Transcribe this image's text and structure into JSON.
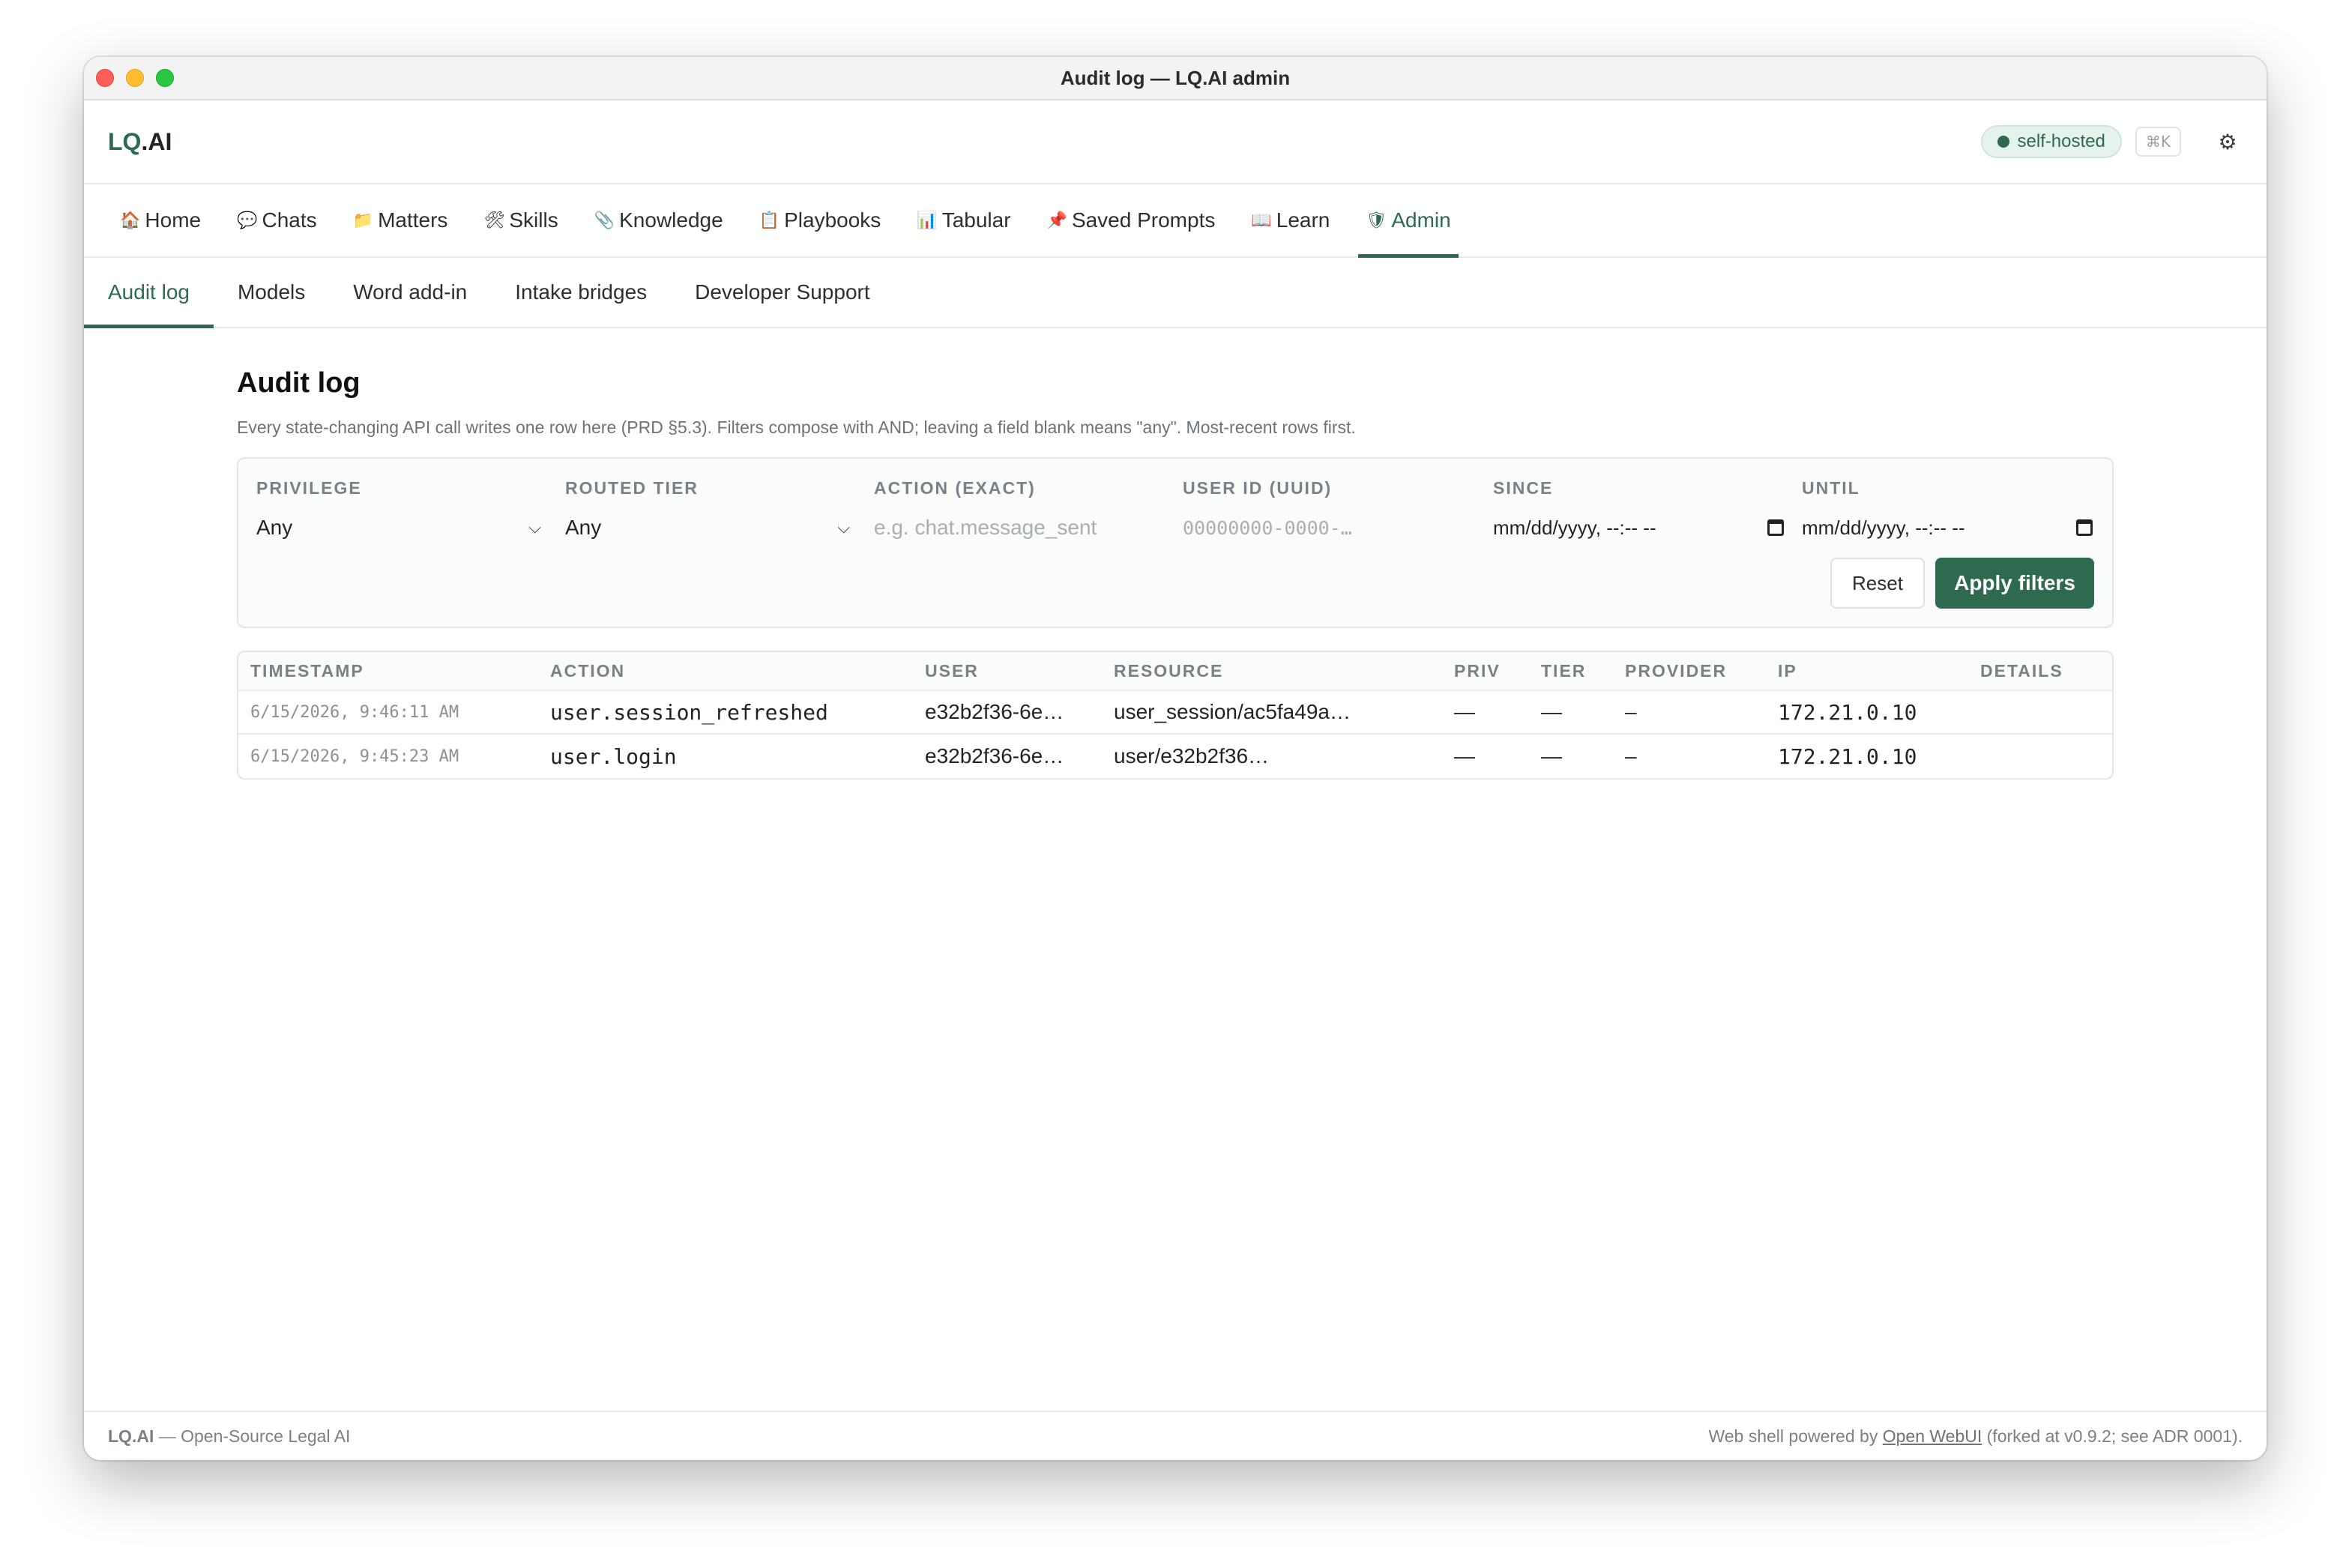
{
  "window": {
    "title": "Audit log — LQ.AI admin"
  },
  "header": {
    "logo_prefix": "LQ",
    "logo_suffix": ".AI",
    "badge": "self-hosted",
    "shortcut": "⌘K",
    "settings_icon": "gear-icon"
  },
  "nav": [
    {
      "emoji": "🏠",
      "icon": "home-icon",
      "label": "Home"
    },
    {
      "emoji": "💬",
      "icon": "chat-bubble-icon",
      "label": "Chats"
    },
    {
      "emoji": "📁",
      "icon": "folder-icon",
      "label": "Matters"
    },
    {
      "emoji": "🛠",
      "icon": "tools-icon",
      "label": "Skills"
    },
    {
      "emoji": "📎",
      "icon": "paperclip-icon",
      "label": "Knowledge"
    },
    {
      "emoji": "📋",
      "icon": "clipboard-icon",
      "label": "Playbooks"
    },
    {
      "emoji": "📊",
      "icon": "bar-chart-icon",
      "label": "Tabular"
    },
    {
      "emoji": "📌",
      "icon": "pushpin-icon",
      "label": "Saved Prompts"
    },
    {
      "emoji": "📖",
      "icon": "book-icon",
      "label": "Learn"
    },
    {
      "emoji": "🛡",
      "icon": "shield-icon",
      "label": "Admin"
    }
  ],
  "active_nav": "Admin",
  "subnav": [
    "Audit log",
    "Models",
    "Word add-in",
    "Intake bridges",
    "Developer Support"
  ],
  "active_subnav": "Audit log",
  "page": {
    "title": "Audit log",
    "description": "Every state-changing API call writes one row here (PRD §5.3). Filters compose with AND; leaving a field blank means \"any\". Most-recent rows first."
  },
  "filters": {
    "privilege": {
      "label": "Privilege",
      "value": "Any"
    },
    "routed_tier": {
      "label": "Routed tier",
      "value": "Any"
    },
    "action": {
      "label": "Action (exact)",
      "placeholder": "e.g. chat.message_sent"
    },
    "user_id": {
      "label": "User ID (UUID)",
      "placeholder": "00000000-0000-…"
    },
    "since": {
      "label": "Since",
      "value": "mm/dd/yyyy, --:-- --"
    },
    "until": {
      "label": "Until",
      "value": "mm/dd/yyyy, --:-- --"
    },
    "reset_label": "Reset",
    "apply_label": "Apply filters"
  },
  "table": {
    "columns": [
      "Timestamp",
      "Action",
      "User",
      "Resource",
      "Priv",
      "Tier",
      "Provider",
      "IP",
      "Details"
    ],
    "rows": [
      {
        "timestamp": "6/15/2026, 9:46:11 AM",
        "action": "user.session_refreshed",
        "user": "e32b2f36-6e…",
        "resource": "user_session/ac5fa49a…",
        "priv": "—",
        "tier": "—",
        "provider": "–",
        "ip": "172.21.0.10",
        "details": ""
      },
      {
        "timestamp": "6/15/2026, 9:45:23 AM",
        "action": "user.login",
        "user": "e32b2f36-6e…",
        "resource": "user/e32b2f36…",
        "priv": "—",
        "tier": "—",
        "provider": "–",
        "ip": "172.21.0.10",
        "details": ""
      }
    ]
  },
  "footer": {
    "brand": "LQ.AI",
    "tagline": " — Open-Source Legal AI",
    "powered_prefix": "Web shell powered by ",
    "powered_link": "Open WebUI",
    "powered_suffix": " (forked at v0.9.2; see ADR 0001)."
  },
  "colors": {
    "accent": "#2d6a4f",
    "badge_bg": "#e6f2ec"
  }
}
